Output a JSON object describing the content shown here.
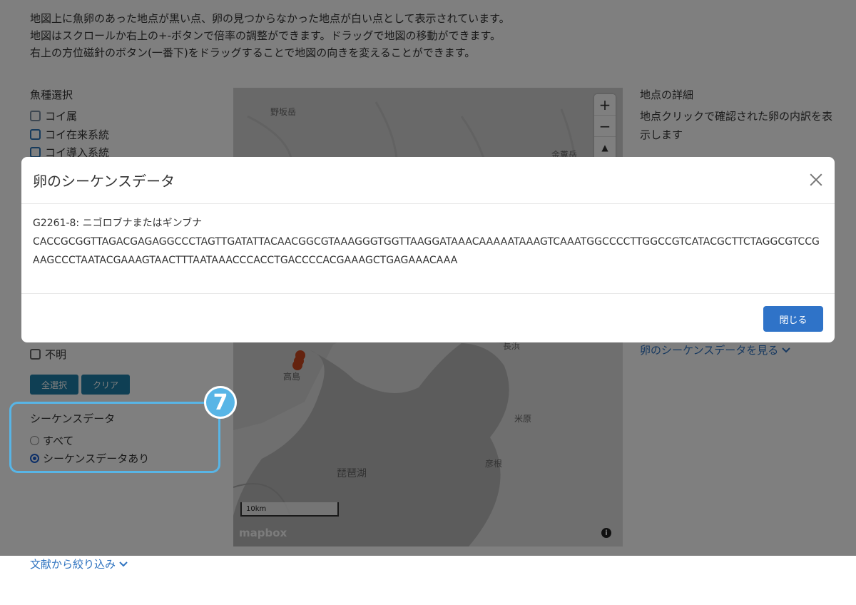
{
  "intro": {
    "line1": "地図上に魚卵のあった地点が黒い点、卵の見つからなかった地点が白い点として表示されています。",
    "line2": "地図はスクロールか右上の+-ボタンで倍率の調整ができます。ドラッグで地図の移動ができます。",
    "line3": "右上の方位磁針のボタン(一番下)をドラッグすることで地図の向きを変えることができます。"
  },
  "species_filter": {
    "title": "魚種選択",
    "items": [
      "コイ属",
      "コイ在来系統",
      "コイ導入系統"
    ],
    "unknown_label": "不明",
    "select_all": "全選択",
    "clear": "クリア"
  },
  "sequence_filter": {
    "title": "シーケンスデータ",
    "badge_number": "7",
    "options": [
      "すべて",
      "シーケンスデータあり"
    ],
    "selected": "シーケンスデータあり"
  },
  "map": {
    "labels": [
      "野坂岳",
      "金糞岳",
      "長浜",
      "高島",
      "米原",
      "彦根",
      "琵琶湖"
    ],
    "zoom_in": "+",
    "zoom_out": "−",
    "compass": "▲",
    "scale": "10km",
    "attribution": "mapbox",
    "info": "i",
    "marker_color": "#c9471f"
  },
  "details": {
    "title": "地点の詳細",
    "description": "地点クリックで確認された卵の内訳を表示します",
    "sequence_link": "卵のシーケンスデータを見る"
  },
  "reference_link": "文献から絞り込み",
  "modal": {
    "title": "卵のシーケンスデータ",
    "sample_id": "G2261-8: ニゴロブナまたはギンブナ",
    "sequence": "CACCGCGGTTAGACGAGAGGCCCTAGTTGATATTACAACGGCGTAAAGGGTGGTTAAGGATAAACAAAAATAAAGTCAAATGGCCCCTTGGCCGTCATACGCTTCTAGGCGTCCGAAGCCCTAATACGAAAGTAACTTTAATAAACCCACCTGACCCCACGAAAGCTGAGAAACAAA",
    "close_label": "閉じる"
  }
}
